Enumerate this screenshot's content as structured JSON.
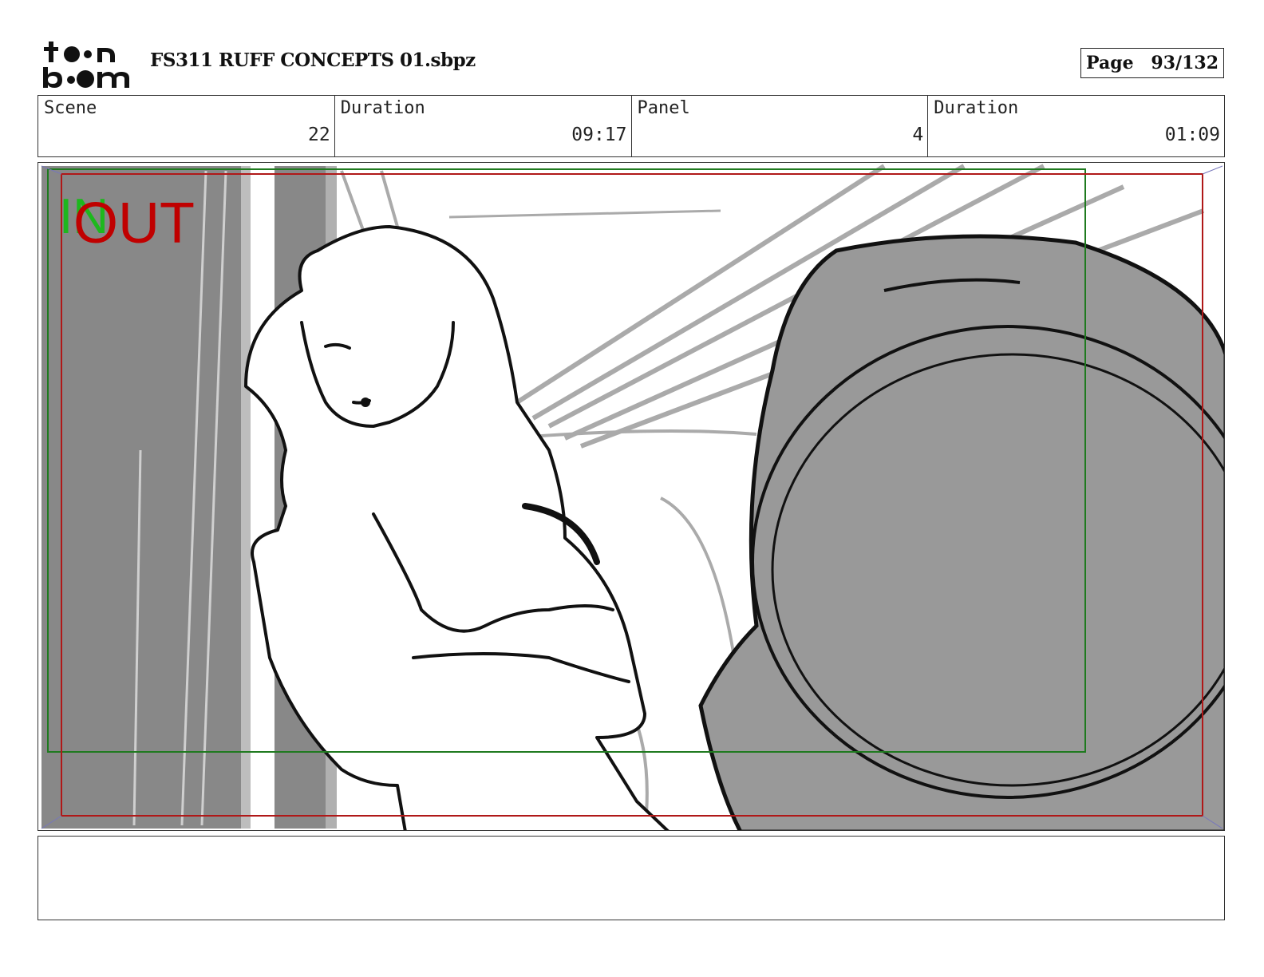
{
  "header": {
    "logo_text_top": "toon",
    "logo_text_bottom": "boom",
    "file_title": "FS311 RUFF CONCEPTS 01.sbpz",
    "page_label": "Page",
    "page_value": "93/132"
  },
  "info": {
    "scene_label": "Scene",
    "scene_value": "22",
    "duration_label": "Duration",
    "duration_value": "09:17",
    "panel_label": "Panel",
    "panel_value": "4",
    "panel_duration_label": "Duration",
    "panel_duration_value": "01:09"
  },
  "panel": {
    "in_marker": "IN",
    "out_marker": "OUT",
    "in_color": "#1db81d",
    "out_color": "#c00000"
  },
  "caption": {
    "text": ""
  }
}
